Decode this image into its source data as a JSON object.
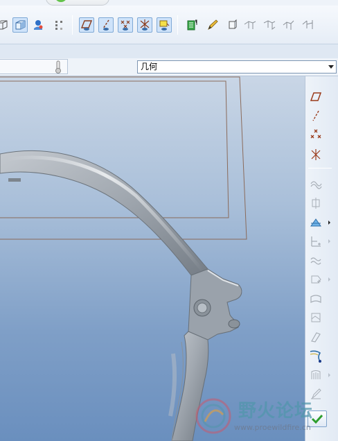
{
  "filter": {
    "selected": "几何"
  },
  "watermark": {
    "brand": "野火论坛",
    "url": "www.proewildfire.cn"
  },
  "colors": {
    "viewport_top": "#c9d6e6",
    "viewport_bottom": "#6a8fbe",
    "model": "#9aa2ab",
    "datum_plane": "#8a6a5a",
    "accept": "#2e9e2e"
  },
  "icons": {
    "toolbar": [
      "box-corner-icon",
      "shaded-view-icon",
      "appearance-icon",
      "layout-dots-icon",
      "plane-display-icon",
      "axis-display-icon",
      "point-display-icon",
      "csys-display-icon",
      "annotation-display-icon",
      "regenerate-icon",
      "sketch-pencil-icon",
      "shaded-cube-icon",
      "view-wire-icon",
      "view-hidden-icon",
      "view-nohidden-icon",
      "view-shaded-icon"
    ],
    "right_toolbar": [
      "datum-plane-icon",
      "datum-axis-icon",
      "datum-point-icon",
      "csys-icon",
      "curve-icon",
      "revolve-icon",
      "sweep-icon",
      "blend-icon",
      "wave-icon",
      "flat-surface-icon",
      "fill-icon",
      "draft-icon",
      "rib-icon",
      "shell-icon",
      "pattern-icon",
      "sketch-icon"
    ]
  }
}
